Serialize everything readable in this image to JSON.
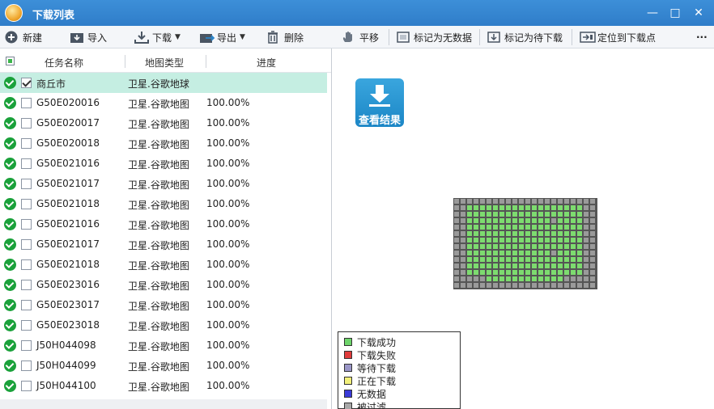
{
  "window": {
    "title": "下载列表",
    "icon": "globe-icon",
    "controls": [
      "minimize-icon",
      "maximize-icon",
      "close-icon"
    ]
  },
  "toolbar": {
    "new_label": "新建",
    "import_label": "导入",
    "download_label": "下载",
    "export_label": "导出",
    "delete_label": "删除",
    "pan_label": "平移",
    "mark_nodata_label": "标记为无数据",
    "mark_pending_label": "标记为待下载",
    "locate_label": "定位到下载点",
    "more_label": "···"
  },
  "table": {
    "columns": [
      "任务名称",
      "地图类型",
      "进度"
    ],
    "rows": [
      {
        "name": "商丘市",
        "type": "卫星.谷歌地球",
        "progress": "",
        "checked": true,
        "selected": true
      },
      {
        "name": "G50E020016",
        "type": "卫星.谷歌地图",
        "progress": "100.00%",
        "checked": false,
        "selected": false
      },
      {
        "name": "G50E020017",
        "type": "卫星.谷歌地图",
        "progress": "100.00%",
        "checked": false,
        "selected": false
      },
      {
        "name": "G50E020018",
        "type": "卫星.谷歌地图",
        "progress": "100.00%",
        "checked": false,
        "selected": false
      },
      {
        "name": "G50E021016",
        "type": "卫星.谷歌地图",
        "progress": "100.00%",
        "checked": false,
        "selected": false
      },
      {
        "name": "G50E021017",
        "type": "卫星.谷歌地图",
        "progress": "100.00%",
        "checked": false,
        "selected": false
      },
      {
        "name": "G50E021018",
        "type": "卫星.谷歌地图",
        "progress": "100.00%",
        "checked": false,
        "selected": false
      },
      {
        "name": "G50E021016",
        "type": "卫星.谷歌地图",
        "progress": "100.00%",
        "checked": false,
        "selected": false
      },
      {
        "name": "G50E021017",
        "type": "卫星.谷歌地图",
        "progress": "100.00%",
        "checked": false,
        "selected": false
      },
      {
        "name": "G50E021018",
        "type": "卫星.谷歌地图",
        "progress": "100.00%",
        "checked": false,
        "selected": false
      },
      {
        "name": "G50E023016",
        "type": "卫星.谷歌地图",
        "progress": "100.00%",
        "checked": false,
        "selected": false
      },
      {
        "name": "G50E023017",
        "type": "卫星.谷歌地图",
        "progress": "100.00%",
        "checked": false,
        "selected": false
      },
      {
        "name": "G50E023018",
        "type": "卫星.谷歌地图",
        "progress": "100.00%",
        "checked": false,
        "selected": false
      },
      {
        "name": "J50H044098",
        "type": "卫星.谷歌地图",
        "progress": "100.00%",
        "checked": false,
        "selected": false
      },
      {
        "name": "J50H044099",
        "type": "卫星.谷歌地图",
        "progress": "100.00%",
        "checked": false,
        "selected": false
      },
      {
        "name": "J50H044100",
        "type": "卫星.谷歌地图",
        "progress": "100.00%",
        "checked": false,
        "selected": false
      }
    ]
  },
  "view_button": {
    "label": "查看结果",
    "icon": "download-icon"
  },
  "tile_grid": {
    "columns": 22,
    "rows": 14,
    "colors": {
      "success": "#7ddb6f",
      "pending": "#9a9a9a"
    }
  },
  "legend": {
    "items": [
      {
        "label": "下载成功",
        "color": "#6ed46b"
      },
      {
        "label": "下载失败",
        "color": "#e03b3b"
      },
      {
        "label": "等待下载",
        "color": "#9a96c8"
      },
      {
        "label": "正在下载",
        "color": "#f2f07a"
      },
      {
        "label": "无数据",
        "color": "#3a3ad8"
      },
      {
        "label": "被过滤",
        "color": "#a8a8a8"
      }
    ]
  }
}
